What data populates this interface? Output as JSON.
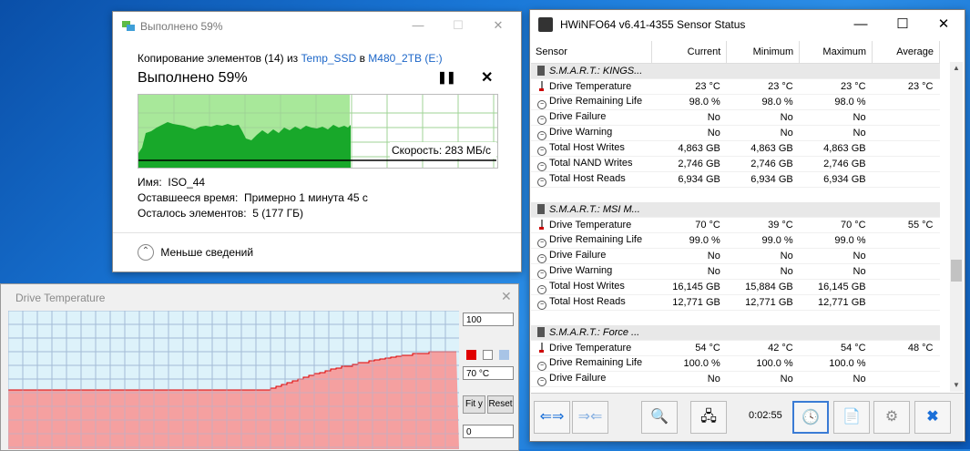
{
  "copy_dialog": {
    "title": "Выполнено 59%",
    "status_prefix": "Копирование элементов (14) из",
    "source": "Temp_SSD",
    "in_word": "в",
    "destination": "M480_2TB (E:)",
    "percent_text": "Выполнено 59%",
    "speed_text": "Скорость: 283 МБ/с",
    "name_label": "Имя:",
    "name_value": "ISO_44",
    "time_label": "Оставшееся время:",
    "time_value": "Примерно 1 минута 45 с",
    "items_label": "Осталось элементов:",
    "items_value": "5 (177 ГБ)",
    "less_details": "Меньше сведений",
    "progress_fraction": 0.59,
    "colors": {
      "fill_light": "#a8e89a",
      "fill_dark": "#18a82a",
      "link": "#1c66c8"
    }
  },
  "drive_temp_window": {
    "title": "Drive Temperature",
    "max_value": "100",
    "current_value": "70 °C",
    "min_value": "0",
    "fit_button": "Fit y",
    "reset_button": "Reset",
    "colors": {
      "plot_bg": "#ddf2fa",
      "fill": "#f5a0a0",
      "line": "#e00000",
      "grid": "#9ec3d8"
    }
  },
  "hwinfo": {
    "title": "HWiNFO64 v6.41-4355 Sensor Status",
    "columns": [
      "Sensor",
      "Current",
      "Minimum",
      "Maximum",
      "Average"
    ],
    "groups": [
      {
        "name": "S.M.A.R.T.: KINGS...",
        "rows": [
          {
            "icon": "thermometer",
            "name": "Drive Temperature",
            "current": "23 °C",
            "minimum": "23 °C",
            "maximum": "23 °C",
            "average": "23 °C"
          },
          {
            "icon": "round",
            "name": "Drive Remaining Life",
            "current": "98.0 %",
            "minimum": "98.0 %",
            "maximum": "98.0 %",
            "average": ""
          },
          {
            "icon": "round",
            "name": "Drive Failure",
            "current": "No",
            "minimum": "No",
            "maximum": "No",
            "average": ""
          },
          {
            "icon": "round",
            "name": "Drive Warning",
            "current": "No",
            "minimum": "No",
            "maximum": "No",
            "average": ""
          },
          {
            "icon": "round",
            "name": "Total Host Writes",
            "current": "4,863 GB",
            "minimum": "4,863 GB",
            "maximum": "4,863 GB",
            "average": ""
          },
          {
            "icon": "round",
            "name": "Total NAND Writes",
            "current": "2,746 GB",
            "minimum": "2,746 GB",
            "maximum": "2,746 GB",
            "average": ""
          },
          {
            "icon": "round",
            "name": "Total Host Reads",
            "current": "6,934 GB",
            "minimum": "6,934 GB",
            "maximum": "6,934 GB",
            "average": ""
          }
        ]
      },
      {
        "name": "S.M.A.R.T.: MSI M...",
        "rows": [
          {
            "icon": "thermometer",
            "name": "Drive Temperature",
            "current": "70 °C",
            "minimum": "39 °C",
            "maximum": "70 °C",
            "average": "55 °C"
          },
          {
            "icon": "round",
            "name": "Drive Remaining Life",
            "current": "99.0 %",
            "minimum": "99.0 %",
            "maximum": "99.0 %",
            "average": ""
          },
          {
            "icon": "round",
            "name": "Drive Failure",
            "current": "No",
            "minimum": "No",
            "maximum": "No",
            "average": ""
          },
          {
            "icon": "round",
            "name": "Drive Warning",
            "current": "No",
            "minimum": "No",
            "maximum": "No",
            "average": ""
          },
          {
            "icon": "round",
            "name": "Total Host Writes",
            "current": "16,145 GB",
            "minimum": "15,884 GB",
            "maximum": "16,145 GB",
            "average": ""
          },
          {
            "icon": "round",
            "name": "Total Host Reads",
            "current": "12,771 GB",
            "minimum": "12,771 GB",
            "maximum": "12,771 GB",
            "average": ""
          }
        ]
      },
      {
        "name": "S.M.A.R.T.: Force ...",
        "rows": [
          {
            "icon": "thermometer",
            "name": "Drive Temperature",
            "current": "54 °C",
            "minimum": "42 °C",
            "maximum": "54 °C",
            "average": "48 °C"
          },
          {
            "icon": "round",
            "name": "Drive Remaining Life",
            "current": "100.0 %",
            "minimum": "100.0 %",
            "maximum": "100.0 %",
            "average": ""
          },
          {
            "icon": "round",
            "name": "Drive Failure",
            "current": "No",
            "minimum": "No",
            "maximum": "No",
            "average": ""
          }
        ]
      }
    ],
    "elapsed_time": "0:02:55"
  }
}
